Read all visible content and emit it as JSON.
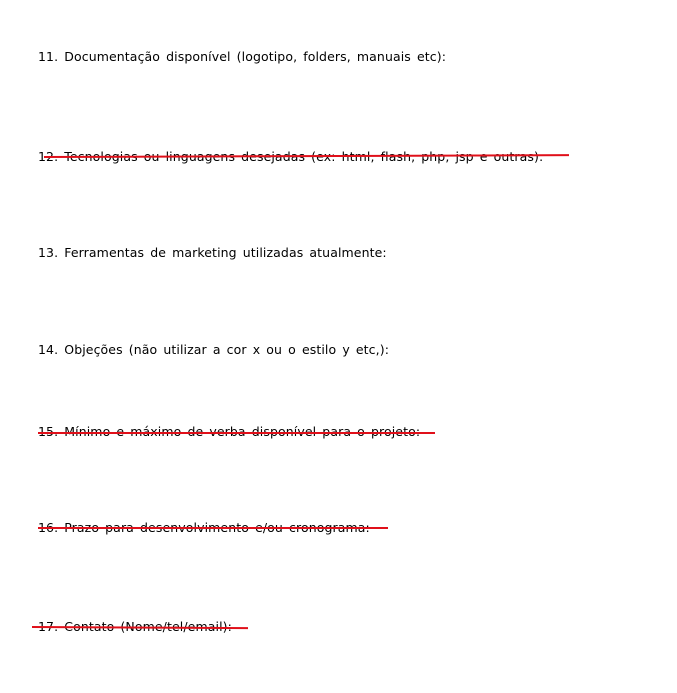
{
  "items": [
    {
      "text": "11. Documentação disponível (logotipo, folders, manuais etc):",
      "struck": false
    },
    {
      "text": "12. Tecnologias ou linguagens desejadas (ex: html, flash, php, jsp e outras):",
      "struck": true
    },
    {
      "text": "13. Ferramentas de marketing utilizadas atualmente:",
      "struck": false
    },
    {
      "text": "14. Objeções (não utilizar a cor x ou o estilo y etc,):",
      "struck": false
    },
    {
      "text": "15. Mínimo e máximo de verba disponível para o projeto:",
      "struck": true
    },
    {
      "text": "16. Prazo para desenvolvimento e/ou cronograma:",
      "struck": true
    },
    {
      "text": "17. Contato (Nome/tel/email):",
      "struck": true
    }
  ],
  "colors": {
    "strike": "#e0101a"
  }
}
